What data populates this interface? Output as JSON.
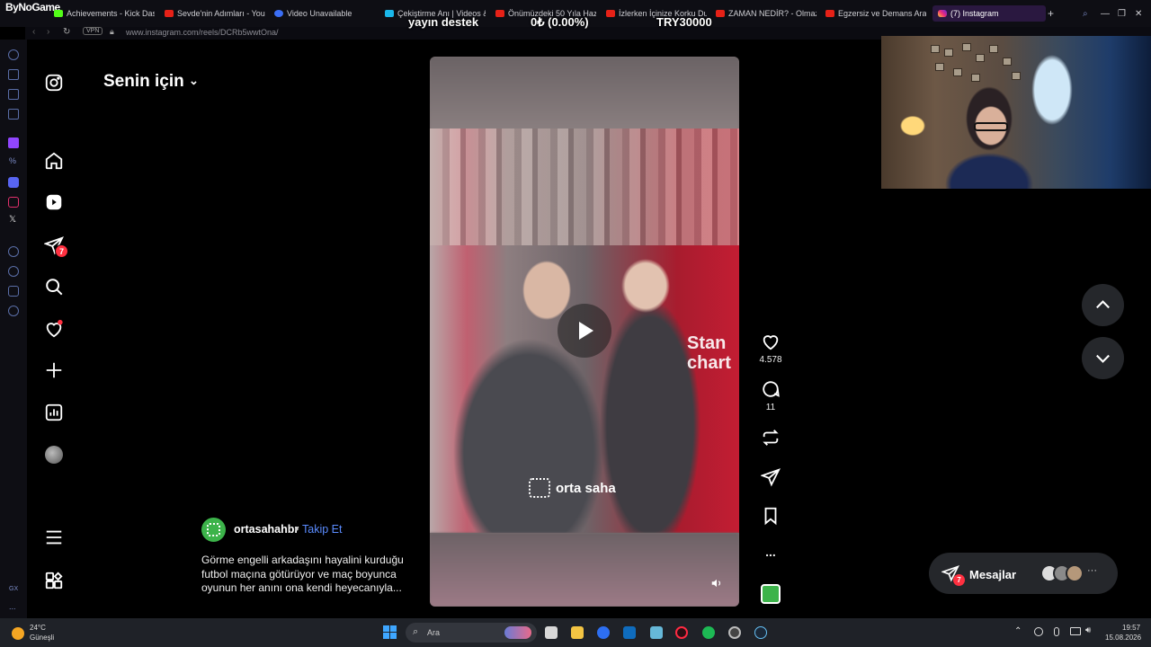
{
  "browser": {
    "brand": "ByNoGame",
    "tabs": [
      {
        "label": "Achievements - Kick Das",
        "icon": "kick-icon"
      },
      {
        "label": "Sevde'nin Adımları - You",
        "icon": "youtube-icon"
      },
      {
        "label": "Video Unavailable",
        "icon": "opera-icon"
      },
      {
        "label": "Çekiştirme Anı | Videos &",
        "icon": "vimeo-icon"
      },
      {
        "label": "Önümüzdeki 50 Yıla Haz",
        "icon": "youtube-icon"
      },
      {
        "label": "İzlerken İçinize Korku Du",
        "icon": "youtube-icon"
      },
      {
        "label": "ZAMAN NEDİR? - Olmaz",
        "icon": "youtube-icon"
      },
      {
        "label": "Egzersiz ve Demans Aras",
        "icon": "youtube-icon"
      },
      {
        "label": "(7) Instagram",
        "icon": "instagram-icon",
        "active": true
      }
    ],
    "vpn_label": "VPN",
    "url": "www.instagram.com/reels/DCRb5wwtOna/"
  },
  "overlay": {
    "support_label": "yayın destek",
    "progress": "0₺ (0.00%)",
    "goal": "TRY30000"
  },
  "instagram": {
    "feed_title": "Senin için",
    "notification_badge": "7",
    "post": {
      "username": "ortasahahbr",
      "separator": "•",
      "follow_label": "Takip Et",
      "caption": "Görme engelli arkadaşını hayalini kurduğu futbol maçına götürüyor ve maç boyunca oyunun her anını ona kendi heyecanıyla...",
      "watermark": "orta saha"
    },
    "actions": {
      "likes": "4.578",
      "comments": "11",
      "more": "..."
    },
    "messages": {
      "label": "Mesajlar",
      "badge": "7",
      "more": "···"
    }
  },
  "taskbar": {
    "temperature": "24°C",
    "weather": "Güneşli",
    "search_placeholder": "Ara",
    "time": "19:57",
    "date": "15.08.2026",
    "sidebar_gx": "GX",
    "sidebar_more": "..."
  },
  "colors": {
    "accent_blue": "#5b8cff",
    "badge_red": "#ff3040",
    "tab_active": "#2a1840"
  }
}
